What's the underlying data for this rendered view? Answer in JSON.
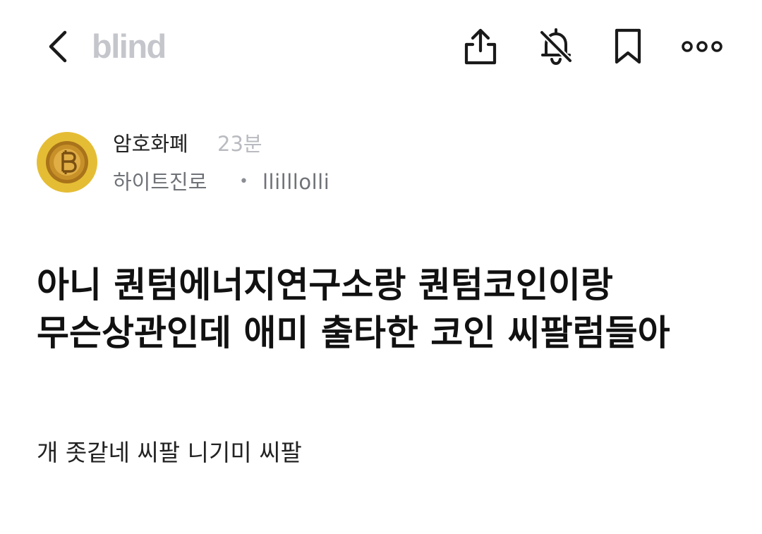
{
  "header": {
    "logo_text": "blind",
    "icons": {
      "back": "chevron-left-icon",
      "share": "share-icon",
      "notifications": "bell-off-icon",
      "bookmark": "bookmark-icon",
      "more": "more-horizontal-icon"
    }
  },
  "author": {
    "board": "암호화폐",
    "time_ago": "23분",
    "company": "하이트진로",
    "separator": "•",
    "nickname": "llilllolli",
    "avatar_icon": "bitcoin-coin-icon"
  },
  "post": {
    "title": "아니 퀀텀에너지연구소랑 퀀텀코인이랑 무슨상관인데 애미 출타한 코인 씨팔럼들아",
    "body": "개 좃같네 씨팔 니기미 씨팔"
  },
  "colors": {
    "logo": "#c4c6cc",
    "avatar_bg": "#e5bd35",
    "muted_text": "#b9bbc0",
    "secondary_text": "#6f7277",
    "primary_text": "#111111"
  }
}
